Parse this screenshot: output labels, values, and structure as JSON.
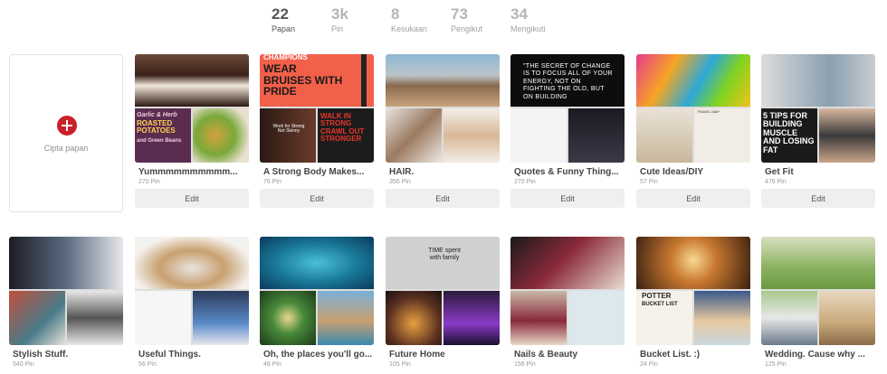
{
  "stats": [
    {
      "value": "22",
      "label": "Papan"
    },
    {
      "value": "3k",
      "label": "Pin"
    },
    {
      "value": "8",
      "label": "Kesukaan"
    },
    {
      "value": "73",
      "label": "Pengikut"
    },
    {
      "value": "34",
      "label": "Mengikuti"
    }
  ],
  "create_board": {
    "label": "Cipta papan"
  },
  "edit_label": "Edit",
  "boards": [
    {
      "title": "Yummmmmmmmmm...",
      "pins": "270 Pin",
      "cover_texts": [
        "Garlic & Herb",
        "ROASTED POTATOES",
        "and Green Beans"
      ]
    },
    {
      "title": "A Strong Body Makes...",
      "pins": "76 Pin",
      "cover_texts": [
        "CHAMPIONS",
        "WEAR BRUISES WITH PRIDE",
        "Work for Strong Not Skinny",
        "WALK IN STRONG CRAWL OUT STRONGER"
      ]
    },
    {
      "title": "HAIR.",
      "pins": "356 Pin",
      "cover_texts": []
    },
    {
      "title": "Quotes & Funny Thing...",
      "pins": "270 Pin",
      "cover_texts": [
        "\"THE SECRET OF CHANGE IS TO FOCUS ALL OF YOUR ENERGY, NOT ON FIGHTING THE OLD, BUT ON BUILDING"
      ]
    },
    {
      "title": "Cute Ideas/DIY",
      "pins": "57 Pin",
      "cover_texts": [
        "TRAVEL MAP"
      ]
    },
    {
      "title": "Get Fit",
      "pins": "476 Pin",
      "cover_texts": [
        "5 TIPS FOR BUILDING MUSCLE AND LOSING FAT"
      ]
    },
    {
      "title": "Stylish Stuff.",
      "pins": "540 Pin",
      "cover_texts": []
    },
    {
      "title": "Useful Things.",
      "pins": "56 Pin",
      "cover_texts": []
    },
    {
      "title": "Oh, the places you'll go...",
      "pins": "48 Pin",
      "cover_texts": []
    },
    {
      "title": "Future Home",
      "pins": "105 Pin",
      "cover_texts": [
        "TIME spent with family"
      ]
    },
    {
      "title": "Nails & Beauty",
      "pins": "156 Pin",
      "cover_texts": []
    },
    {
      "title": "Bucket List. :)",
      "pins": "24 Pin",
      "cover_texts": [
        "POTTER",
        "BUCKET LIST"
      ]
    },
    {
      "title": "Wedding. Cause why ...",
      "pins": "125 Pin",
      "cover_texts": []
    }
  ],
  "colors": {
    "accent": "#cb2027",
    "edit_bg": "#efefef",
    "stat_active": "#555555",
    "stat_muted": "#b5b5b5"
  }
}
